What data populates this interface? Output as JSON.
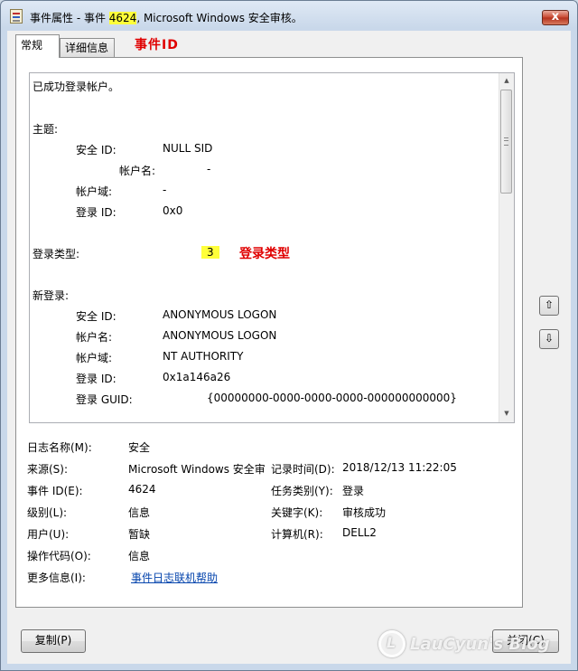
{
  "window": {
    "title_prefix": "事件属性 - 事件 ",
    "title_event_id": "4624",
    "title_suffix": ", Microsoft Windows 安全审核。",
    "close_glyph": "x"
  },
  "tabs": [
    {
      "label": "常规",
      "selected": true
    },
    {
      "label": "详细信息",
      "selected": false
    }
  ],
  "annotations": {
    "event_id_label": "事件ID",
    "logon_type_badge": "3",
    "logon_type_label": "登录类型"
  },
  "description": {
    "summary": "已成功登录帐户。",
    "subject_header": "主题:",
    "subject": {
      "security_id_label": "安全 ID:",
      "security_id": "NULL SID",
      "account_name_label": "帐户名:",
      "account_name": "-",
      "account_domain_label": "帐户域:",
      "account_domain": "-",
      "logon_id_label": "登录 ID:",
      "logon_id": "0x0"
    },
    "logon_type_label": "登录类型:",
    "new_logon_header": "新登录:",
    "new_logon": {
      "security_id_label": "安全 ID:",
      "security_id": "ANONYMOUS LOGON",
      "account_name_label": "帐户名:",
      "account_name": "ANONYMOUS LOGON",
      "account_domain_label": "帐户域:",
      "account_domain": "NT AUTHORITY",
      "logon_id_label": "登录 ID:",
      "logon_id": "0x1a146a26",
      "logon_guid_label": "登录 GUID:",
      "logon_guid": "{00000000-0000-0000-0000-000000000000}"
    }
  },
  "meta": {
    "log_name_label": "日志名称(M):",
    "log_name": "安全",
    "source_label": "来源(S):",
    "source": "Microsoft Windows 安全审",
    "logged_label": "记录时间(D):",
    "logged": "2018/12/13 11:22:05",
    "event_id_label": "事件 ID(E):",
    "event_id": "4624",
    "task_category_label": "任务类别(Y):",
    "task_category": "登录",
    "level_label": "级别(L):",
    "level": "信息",
    "keywords_label": "关键字(K):",
    "keywords": "审核成功",
    "user_label": "用户(U):",
    "user": "暂缺",
    "computer_label": "计算机(R):",
    "computer": "DELL2",
    "opcode_label": "操作代码(O):",
    "opcode": "信息",
    "more_info_label": "更多信息(I):",
    "more_info_link": "事件日志联机帮助"
  },
  "nav": {
    "up_icon": "arrow-up-icon",
    "down_icon": "arrow-down-icon",
    "up_glyph": "⇧",
    "down_glyph": "⇩"
  },
  "buttons": {
    "copy": "复制(P)",
    "close": "关闭(C)"
  },
  "watermark": {
    "text": "LauCyun's Blog"
  },
  "scroll_position": 0
}
